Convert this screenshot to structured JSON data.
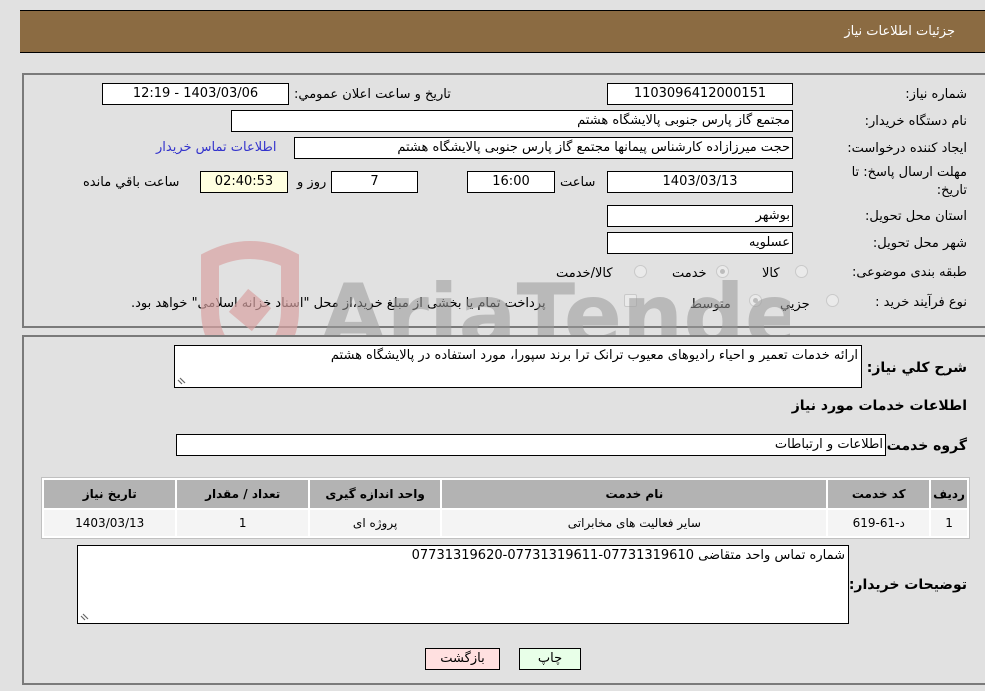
{
  "header": {
    "title": "جزئیات اطلاعات نیاز"
  },
  "form": {
    "need_number_label": "شماره نیاز:",
    "need_number": "1103096412000151",
    "announce_label": "تاریخ و ساعت اعلان عمومي:",
    "announce_value": "1403/03/06 - 12:19",
    "buyer_org_label": "نام دستگاه خریدار:",
    "buyer_org": "مجتمع گاز پارس جنوبی  پالایشگاه هشتم",
    "creator_label": "ایجاد کننده درخواست:",
    "creator": "حجت میرزازاده کارشناس پیمانها مجتمع گاز پارس جنوبی  پالایشگاه هشتم",
    "contact_link": "اطلاعات تماس خریدار",
    "deadline_label_1": "مهلت ارسال پاسخ: تا",
    "deadline_label_2": "تاریخ:",
    "deadline_date": "1403/03/13",
    "time_label": "ساعت",
    "deadline_time": "16:00",
    "days_value": "7",
    "days_label": "روز و",
    "remaining_value": "02:40:53",
    "remaining_label": "ساعت باقي مانده",
    "province_label": "استان محل تحویل:",
    "province": "بوشهر",
    "city_label": "شهر محل تحویل:",
    "city": "عسلویه",
    "category_label": "طبقه بندی موضوعی:",
    "category_options": [
      "کالا",
      "خدمت",
      "کالا/خدمت"
    ],
    "category_selected": "خدمت",
    "process_label": "نوع فرآیند خرید :",
    "process_options": [
      "جزيي",
      "متوسط"
    ],
    "process_selected": "متوسط",
    "treasury_text": "پرداخت تمام یا بخشی از مبلغ خرید،از محل \"اسناد خزانه اسلامی\" خواهد بود."
  },
  "details": {
    "summary_label": "شرح کلي نياز:",
    "summary": "ارائه خدمات تعمیر و احیاء رادیوهای معیوب ترانک ترا برند سپورا، مورد استفاده در پالایشگاه هشتم",
    "services_title": "اطلاعات خدمات مورد نياز",
    "service_group_label": "گروه خدمت:",
    "service_group": "اطلاعات و ارتباطات",
    "table": {
      "headers": [
        "رديف",
        "کد خدمت",
        "نام خدمت",
        "واحد اندازه گيری",
        "تعداد / مقدار",
        "تاريخ نياز"
      ],
      "rows": [
        [
          "1",
          "د-61-619",
          "سایر فعالیت های مخابراتی",
          "پروژه ای",
          "1",
          "1403/03/13"
        ]
      ]
    },
    "buyer_notes_label": "توضيحات خريدار:",
    "buyer_notes": "شماره تماس واحد متقاضی 07731319610-07731319611-07731319620"
  },
  "buttons": {
    "print": "چاپ",
    "back": "بازگشت"
  },
  "watermark": {
    "text": "AriaTender.neT"
  },
  "colors": {
    "header_bg": "#8b6b42",
    "link": "#3333cc",
    "print_bg": "#e8ffe8",
    "back_bg": "#ffe0e0"
  }
}
